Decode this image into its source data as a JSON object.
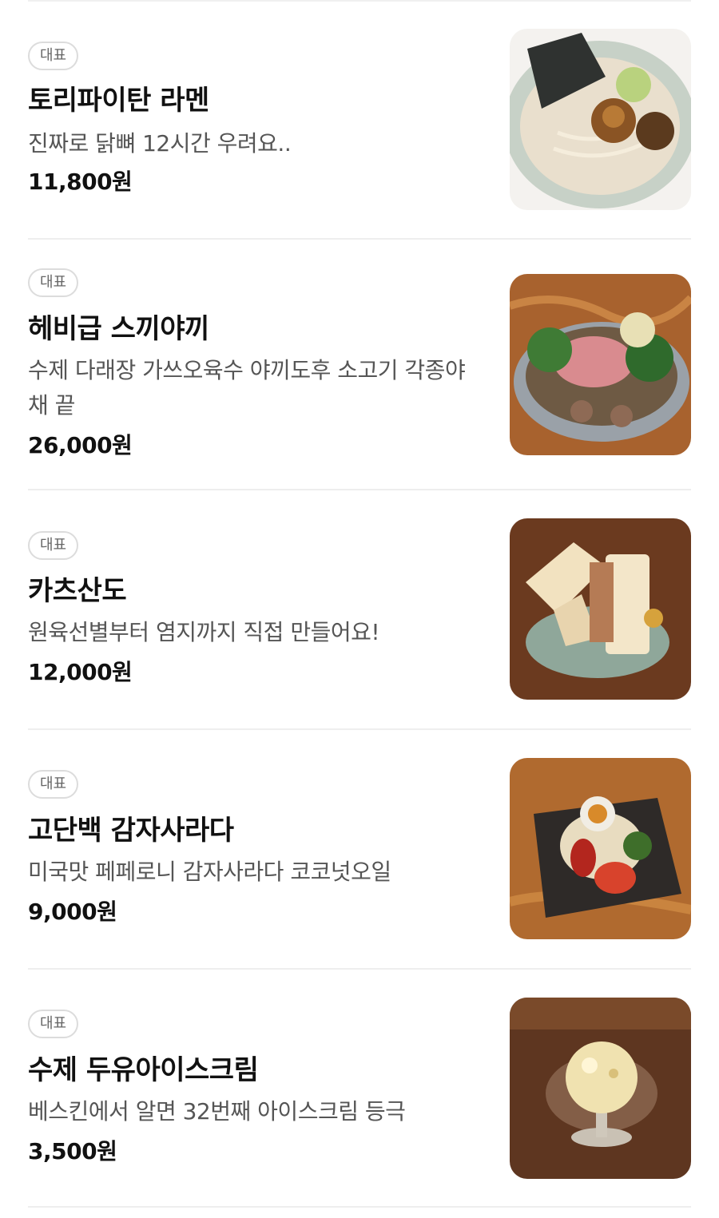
{
  "menu": {
    "items": [
      {
        "badge": "대표",
        "name": "토리파이탄 라멘",
        "description": "진짜로 닭뼈 12시간 우려요..",
        "price": "11,800원",
        "image": "tori-paitan-ramen-photo"
      },
      {
        "badge": "대표",
        "name": "헤비급 스끼야끼",
        "description": "수제 다래장 가쓰오육수 야끼도후 소고기 각종야채 끝",
        "price": "26,000원",
        "image": "sukiyaki-photo"
      },
      {
        "badge": "대표",
        "name": "카츠산도",
        "description": "원육선별부터 염지까지 직접 만들어요!",
        "price": "12,000원",
        "image": "katsu-sando-photo"
      },
      {
        "badge": "대표",
        "name": "고단백 감자사라다",
        "description": "미국맛 페페로니 감자사라다 코코넛오일",
        "price": "9,000원",
        "image": "potato-salad-photo"
      },
      {
        "badge": "대표",
        "name": "수제 두유아이스크림",
        "description": "베스킨에서 알면 32번째 아이스크림 등극",
        "price": "3,500원",
        "image": "soymilk-ice-cream-photo"
      }
    ]
  }
}
